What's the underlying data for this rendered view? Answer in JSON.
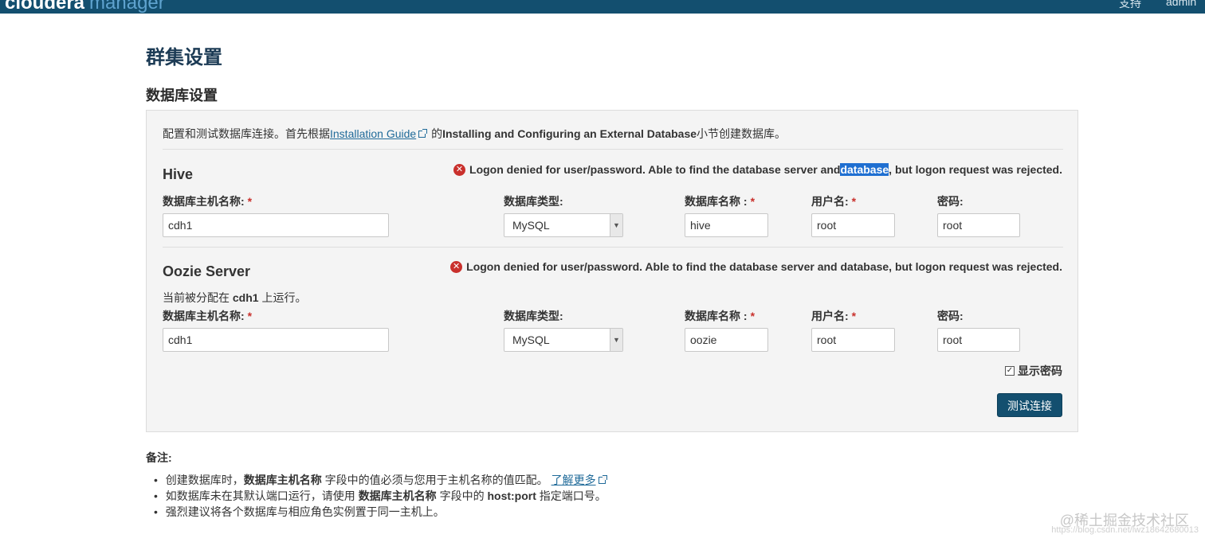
{
  "app": {
    "brand_main": "cloudera",
    "brand_sub": "manager",
    "nav_support": "支持",
    "nav_user": "admin"
  },
  "page": {
    "title": "群集设置",
    "section": "数据库设置"
  },
  "intro": {
    "prefix": "配置和测试数据库连接。首先根据",
    "link": "Installation Guide",
    "middle": " 的",
    "bold": "Installing and Configuring an External Database",
    "suffix": "小节创建数据库。"
  },
  "labels": {
    "host": "数据库主机名称:",
    "db_type": "数据库类型:",
    "db_name": "数据库名称 :",
    "user": "用户名:",
    "password": "密码:",
    "required": "*"
  },
  "hive": {
    "title": "Hive",
    "error_pre": "Logon denied for user/password. Able to find the database server and ",
    "error_hl": "database",
    "error_post": ", but logon request was rejected.",
    "host": "cdh1",
    "db_type": "MySQL",
    "db_name": "hive",
    "user": "root",
    "password": "root"
  },
  "oozie": {
    "title": "Oozie Server",
    "error": "Logon denied for user/password. Able to find the database server and database, but logon request was rejected.",
    "assigned_pre": "当前被分配在 ",
    "assigned_host": "cdh1",
    "assigned_post": " 上运行。",
    "host": "cdh1",
    "db_type": "MySQL",
    "db_name": "oozie",
    "user": "root",
    "password": "root"
  },
  "controls": {
    "show_password": "显示密码",
    "show_password_checked": true,
    "test_button": "测试连接"
  },
  "notes": {
    "title": "备注:",
    "n1_pre": "创建数据库时，",
    "n1_bold": "数据库主机名称",
    "n1_mid": " 字段中的值必须与您用于主机名称的值匹配。 ",
    "n1_link": "了解更多",
    "n2_pre": "如数据库未在其默认端口运行，请使用 ",
    "n2_bold": "数据库主机名称",
    "n2_mid": " 字段中的 ",
    "n2_bold2": "host:port",
    "n2_post": " 指定端口号。",
    "n3": "强烈建议将各个数据库与相应角色实例置于同一主机上。"
  },
  "watermark": {
    "line1": "@稀土掘金技术社区",
    "line2": "https://blog.csdn.net/lwz18642680013"
  },
  "colors": {
    "topbar": "#134f6f",
    "error": "#c9302c",
    "button": "#134f6f",
    "link": "#1f6a99"
  }
}
